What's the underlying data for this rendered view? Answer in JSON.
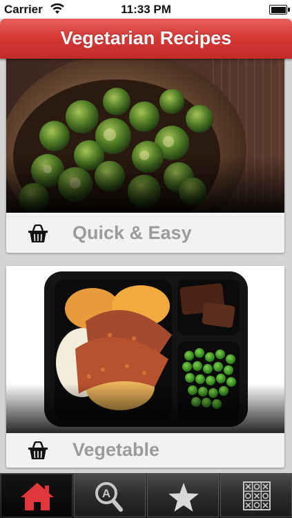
{
  "status_bar": {
    "carrier": "Carrier",
    "time": "11:33 PM"
  },
  "header": {
    "title": "Vegetarian Recipes"
  },
  "categories": [
    {
      "label": "Quick & Easy",
      "icon": "basket-icon",
      "photo": "brussels-sprouts"
    },
    {
      "label": "Vegetable",
      "icon": "basket-icon",
      "photo": "meatloaf-tray-meal"
    }
  ],
  "tabbar": {
    "tabs": [
      {
        "icon": "home-icon",
        "active": true
      },
      {
        "icon": "search-icon",
        "active": false
      },
      {
        "icon": "star-icon",
        "active": false
      },
      {
        "icon": "tic-tac-toe-icon",
        "active": false
      }
    ],
    "active_color": "#e0383a"
  }
}
